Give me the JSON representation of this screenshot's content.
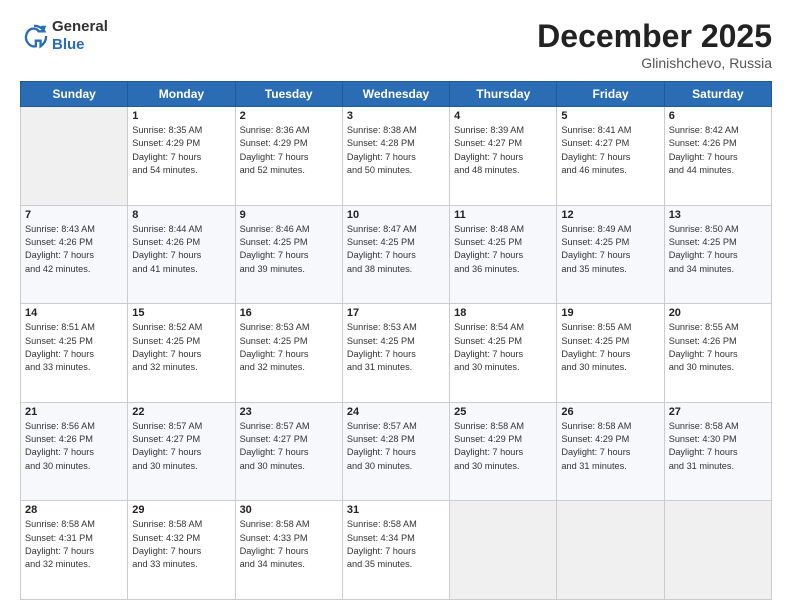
{
  "header": {
    "logo": {
      "general": "General",
      "blue": "Blue"
    },
    "title": "December 2025",
    "location": "Glinishchevo, Russia"
  },
  "days_of_week": [
    "Sunday",
    "Monday",
    "Tuesday",
    "Wednesday",
    "Thursday",
    "Friday",
    "Saturday"
  ],
  "weeks": [
    [
      {
        "day": "",
        "data": ""
      },
      {
        "day": "1",
        "data": "Sunrise: 8:35 AM\nSunset: 4:29 PM\nDaylight: 7 hours\nand 54 minutes."
      },
      {
        "day": "2",
        "data": "Sunrise: 8:36 AM\nSunset: 4:29 PM\nDaylight: 7 hours\nand 52 minutes."
      },
      {
        "day": "3",
        "data": "Sunrise: 8:38 AM\nSunset: 4:28 PM\nDaylight: 7 hours\nand 50 minutes."
      },
      {
        "day": "4",
        "data": "Sunrise: 8:39 AM\nSunset: 4:27 PM\nDaylight: 7 hours\nand 48 minutes."
      },
      {
        "day": "5",
        "data": "Sunrise: 8:41 AM\nSunset: 4:27 PM\nDaylight: 7 hours\nand 46 minutes."
      },
      {
        "day": "6",
        "data": "Sunrise: 8:42 AM\nSunset: 4:26 PM\nDaylight: 7 hours\nand 44 minutes."
      }
    ],
    [
      {
        "day": "7",
        "data": "Sunrise: 8:43 AM\nSunset: 4:26 PM\nDaylight: 7 hours\nand 42 minutes."
      },
      {
        "day": "8",
        "data": "Sunrise: 8:44 AM\nSunset: 4:26 PM\nDaylight: 7 hours\nand 41 minutes."
      },
      {
        "day": "9",
        "data": "Sunrise: 8:46 AM\nSunset: 4:25 PM\nDaylight: 7 hours\nand 39 minutes."
      },
      {
        "day": "10",
        "data": "Sunrise: 8:47 AM\nSunset: 4:25 PM\nDaylight: 7 hours\nand 38 minutes."
      },
      {
        "day": "11",
        "data": "Sunrise: 8:48 AM\nSunset: 4:25 PM\nDaylight: 7 hours\nand 36 minutes."
      },
      {
        "day": "12",
        "data": "Sunrise: 8:49 AM\nSunset: 4:25 PM\nDaylight: 7 hours\nand 35 minutes."
      },
      {
        "day": "13",
        "data": "Sunrise: 8:50 AM\nSunset: 4:25 PM\nDaylight: 7 hours\nand 34 minutes."
      }
    ],
    [
      {
        "day": "14",
        "data": "Sunrise: 8:51 AM\nSunset: 4:25 PM\nDaylight: 7 hours\nand 33 minutes."
      },
      {
        "day": "15",
        "data": "Sunrise: 8:52 AM\nSunset: 4:25 PM\nDaylight: 7 hours\nand 32 minutes."
      },
      {
        "day": "16",
        "data": "Sunrise: 8:53 AM\nSunset: 4:25 PM\nDaylight: 7 hours\nand 32 minutes."
      },
      {
        "day": "17",
        "data": "Sunrise: 8:53 AM\nSunset: 4:25 PM\nDaylight: 7 hours\nand 31 minutes."
      },
      {
        "day": "18",
        "data": "Sunrise: 8:54 AM\nSunset: 4:25 PM\nDaylight: 7 hours\nand 30 minutes."
      },
      {
        "day": "19",
        "data": "Sunrise: 8:55 AM\nSunset: 4:25 PM\nDaylight: 7 hours\nand 30 minutes."
      },
      {
        "day": "20",
        "data": "Sunrise: 8:55 AM\nSunset: 4:26 PM\nDaylight: 7 hours\nand 30 minutes."
      }
    ],
    [
      {
        "day": "21",
        "data": "Sunrise: 8:56 AM\nSunset: 4:26 PM\nDaylight: 7 hours\nand 30 minutes."
      },
      {
        "day": "22",
        "data": "Sunrise: 8:57 AM\nSunset: 4:27 PM\nDaylight: 7 hours\nand 30 minutes."
      },
      {
        "day": "23",
        "data": "Sunrise: 8:57 AM\nSunset: 4:27 PM\nDaylight: 7 hours\nand 30 minutes."
      },
      {
        "day": "24",
        "data": "Sunrise: 8:57 AM\nSunset: 4:28 PM\nDaylight: 7 hours\nand 30 minutes."
      },
      {
        "day": "25",
        "data": "Sunrise: 8:58 AM\nSunset: 4:29 PM\nDaylight: 7 hours\nand 30 minutes."
      },
      {
        "day": "26",
        "data": "Sunrise: 8:58 AM\nSunset: 4:29 PM\nDaylight: 7 hours\nand 31 minutes."
      },
      {
        "day": "27",
        "data": "Sunrise: 8:58 AM\nSunset: 4:30 PM\nDaylight: 7 hours\nand 31 minutes."
      }
    ],
    [
      {
        "day": "28",
        "data": "Sunrise: 8:58 AM\nSunset: 4:31 PM\nDaylight: 7 hours\nand 32 minutes."
      },
      {
        "day": "29",
        "data": "Sunrise: 8:58 AM\nSunset: 4:32 PM\nDaylight: 7 hours\nand 33 minutes."
      },
      {
        "day": "30",
        "data": "Sunrise: 8:58 AM\nSunset: 4:33 PM\nDaylight: 7 hours\nand 34 minutes."
      },
      {
        "day": "31",
        "data": "Sunrise: 8:58 AM\nSunset: 4:34 PM\nDaylight: 7 hours\nand 35 minutes."
      },
      {
        "day": "",
        "data": ""
      },
      {
        "day": "",
        "data": ""
      },
      {
        "day": "",
        "data": ""
      }
    ]
  ]
}
